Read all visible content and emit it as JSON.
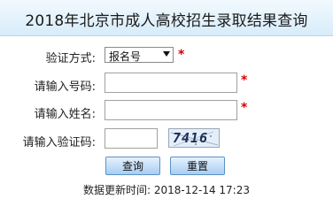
{
  "page": {
    "title": "2018年北京市成人高校招生录取结果查询"
  },
  "form": {
    "method_label": "验证方式:",
    "method_selected": "报名号",
    "number_label": "请输入号码:",
    "number_value": "",
    "name_label": "请输入姓名:",
    "name_value": "",
    "code_label": "请输入验证码:",
    "code_value": "",
    "captcha_text": "7416",
    "required_mark": "*"
  },
  "buttons": {
    "query_label": "查询",
    "reset_label": "重置"
  },
  "footer": {
    "updated_label": "数据更新时间:",
    "updated_value": "2018-12-14 17:23"
  },
  "colors": {
    "header_bg": "#d7ecfa",
    "required": "#d40000",
    "button_bg": "#a7cdf2"
  }
}
